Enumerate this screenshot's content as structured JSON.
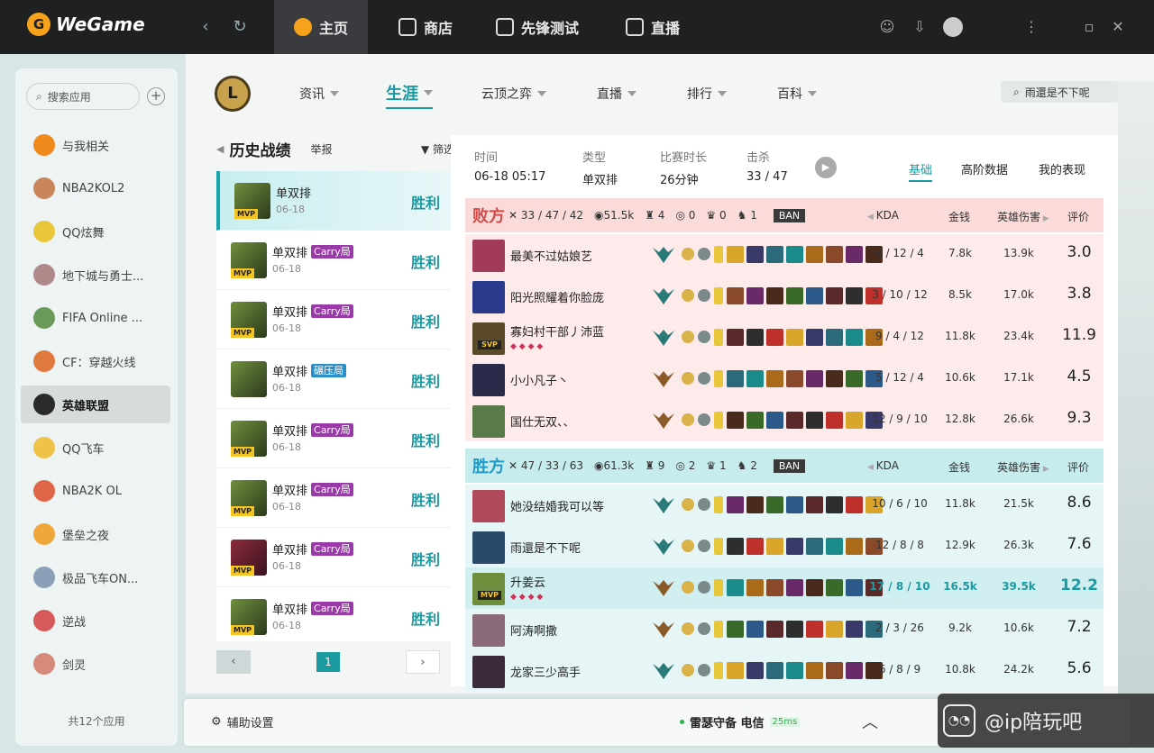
{
  "app": {
    "name": "WeGame"
  },
  "titlebar": {
    "tabs": [
      "主页",
      "商店",
      "先锋测试",
      "直播"
    ]
  },
  "sidebar": {
    "search_placeholder": "搜索应用",
    "items": [
      "与我相关",
      "NBA2KOL2",
      "QQ炫舞",
      "地下城与勇士...",
      "FIFA Online ...",
      "CF：穿越火线",
      "英雄联盟",
      "QQ飞车",
      "NBA2K OL",
      "堡垒之夜",
      "极品飞车ON...",
      "逆战",
      "剑灵"
    ],
    "active_index": 6,
    "count": "共12个应用"
  },
  "gamenav": {
    "items": [
      "资讯",
      "生涯",
      "云顶之弈",
      "直播",
      "排行",
      "百科"
    ],
    "active": "生涯",
    "user": "雨還是不下呢"
  },
  "history": {
    "title": "历史战绩",
    "report": "举报",
    "filter": "筛选",
    "rows": [
      {
        "mode": "单双排",
        "tag": "",
        "tag_color": "",
        "date": "06-18",
        "result": "胜利",
        "mvp": "MVP"
      },
      {
        "mode": "单双排",
        "tag": "Carry局",
        "tag_color": "purple",
        "date": "06-18",
        "result": "胜利",
        "mvp": "MVP"
      },
      {
        "mode": "单双排",
        "tag": "Carry局",
        "tag_color": "purple",
        "date": "06-18",
        "result": "胜利",
        "mvp": "MVP"
      },
      {
        "mode": "单双排",
        "tag": "碾压局",
        "tag_color": "blue",
        "date": "06-18",
        "result": "胜利",
        "mvp": ""
      },
      {
        "mode": "单双排",
        "tag": "Carry局",
        "tag_color": "purple",
        "date": "06-18",
        "result": "胜利",
        "mvp": "MVP"
      },
      {
        "mode": "单双排",
        "tag": "Carry局",
        "tag_color": "purple",
        "date": "06-18",
        "result": "胜利",
        "mvp": "MVP"
      },
      {
        "mode": "单双排",
        "tag": "Carry局",
        "tag_color": "purple",
        "date": "06-18",
        "result": "胜利",
        "mvp": "MVP"
      },
      {
        "mode": "单双排",
        "tag": "Carry局",
        "tag_color": "purple",
        "date": "06-18",
        "result": "胜利",
        "mvp": "MVP"
      }
    ],
    "page": "1"
  },
  "match": {
    "time_label": "时间",
    "time": "06-18 05:17",
    "type_label": "类型",
    "type": "单双排",
    "duration_label": "比赛时长",
    "duration": "26分钟",
    "kills_label": "击杀",
    "kills": "33 / 47",
    "tabs": [
      "基础",
      "高阶数据",
      "我的表现"
    ]
  },
  "columns": {
    "kda": "KDA",
    "gold": "金钱",
    "damage": "英雄伤害",
    "score": "评价"
  },
  "teams": [
    {
      "name": "败方",
      "cls": "lose",
      "kda": "33 / 47 / 42",
      "gold": "51.5k",
      "towers": "4",
      "dragons": "0",
      "barons": "0",
      "heralds": "1",
      "ban": "BAN",
      "players": [
        {
          "name": "最美不过姑娘艺",
          "kda": "4 / 12 / 4",
          "gold": "7.8k",
          "dmg": "13.9k",
          "score": "3.0",
          "badge": ""
        },
        {
          "name": "阳光照耀着你脸庞",
          "kda": "3 / 10 / 12",
          "gold": "8.5k",
          "dmg": "17.0k",
          "score": "3.8",
          "badge": ""
        },
        {
          "name": "寡妇村干部丿沛蓝",
          "kda": "9 / 4 / 12",
          "gold": "11.8k",
          "dmg": "23.4k",
          "score": "11.9",
          "badge": "SVP"
        },
        {
          "name": "小小凡子丶",
          "kda": "5 / 12 / 4",
          "gold": "10.6k",
          "dmg": "17.1k",
          "score": "4.5",
          "badge": ""
        },
        {
          "name": "国仕无双、、",
          "kda": "12 / 9 / 10",
          "gold": "12.8k",
          "dmg": "26.6k",
          "score": "9.3",
          "badge": ""
        }
      ]
    },
    {
      "name": "胜方",
      "cls": "win",
      "kda": "47 / 33 / 63",
      "gold": "61.3k",
      "towers": "9",
      "dragons": "2",
      "barons": "1",
      "heralds": "2",
      "ban": "BAN",
      "players": [
        {
          "name": "她没结婚我可以等",
          "kda": "10 / 6 / 10",
          "gold": "11.8k",
          "dmg": "21.5k",
          "score": "8.6",
          "badge": ""
        },
        {
          "name": "雨還是不下呢",
          "kda": "12 / 8 / 8",
          "gold": "12.9k",
          "dmg": "26.3k",
          "score": "7.6",
          "badge": ""
        },
        {
          "name": "升姜云",
          "kda": "17 / 8 / 10",
          "gold": "16.5k",
          "dmg": "39.5k",
          "score": "12.2",
          "badge": "MVP",
          "me": true
        },
        {
          "name": "阿涛啊撒",
          "kda": "2 / 3 / 26",
          "gold": "9.2k",
          "dmg": "10.6k",
          "score": "7.2",
          "badge": ""
        },
        {
          "name": "龙家三少高手",
          "kda": "6 / 8 / 9",
          "gold": "10.8k",
          "dmg": "24.2k",
          "score": "5.6",
          "badge": ""
        }
      ]
    }
  ],
  "bottom": {
    "assist": "辅助设置",
    "server": "雷瑟守备 电信",
    "ping": "25ms"
  },
  "watermark": "@ip陪玩吧",
  "colors": {
    "accent": "#1b9aa1",
    "lose": "#d24a4a",
    "win": "#1e9bc9"
  }
}
